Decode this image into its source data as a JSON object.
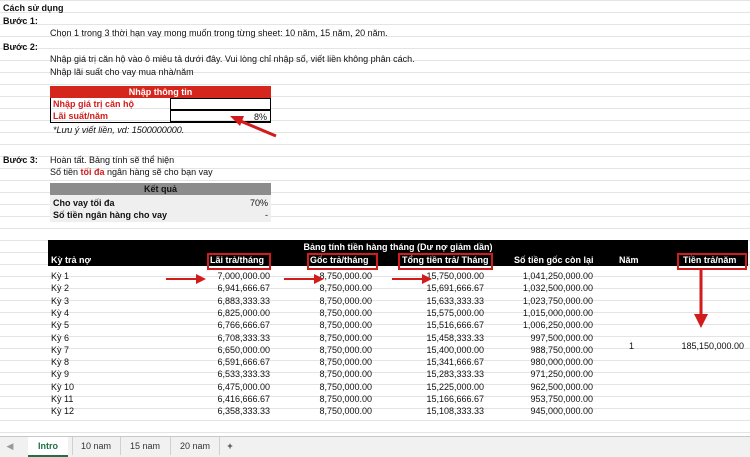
{
  "instructions": {
    "title": "Cách sử dụng",
    "step1_label": "Bước 1:",
    "step1_text": "Chọn 1 trong 3 thời hạn vay mong muốn trong từng sheet: 10 năm, 15 năm, 20 năm.",
    "step2_label": "Bước 2:",
    "step2_text_a": "Nhập giá trị căn hộ vào ô miêu tả dưới đây. Vui lòng chỉ nhập số, viết liền không phân cách.",
    "step2_text_b": "Nhập lãi suất cho vay mua nhà/năm",
    "step3_label": "Bước 3:",
    "step3_text_a": "Hoàn tất. Bảng tính sẽ thể hiện",
    "step3_text_b_pre": "Số tiền ",
    "step3_text_b_em": "tối đa",
    "step3_text_b_post": " ngân hàng sẽ cho bạn vay"
  },
  "input_box": {
    "header": "Nhập thông tin",
    "row1_label": "Nhập giá trị căn hộ",
    "row1_value": "",
    "row2_label": "Lãi suất/năm",
    "row2_value": "8%",
    "note": "*Lưu ý viết liền, vd: 1500000000."
  },
  "result_box": {
    "header": "Kết quả",
    "row1_label": "Cho vay tối đa",
    "row1_value": "70%",
    "row2_label": "Số tiền ngân hàng cho vay",
    "row2_value": "-"
  },
  "schedule": {
    "title": "Bảng tính tiền hàng tháng (Dư nợ giảm dần)",
    "headers": {
      "period": "Kỳ trả nợ",
      "interest": "Lãi trả/tháng",
      "principal": "Gốc trả/tháng",
      "total": "Tổng tiền trả/ Tháng",
      "remaining": "Số tiền gốc còn lại",
      "year": "Năm",
      "yearly": "Tiền trả/năm"
    },
    "rows": [
      {
        "period": "Kỳ 1",
        "interest": "7,000,000.00",
        "principal": "8,750,000.00",
        "total": "15,750,000.00",
        "remaining": "1,041,250,000.00"
      },
      {
        "period": "Kỳ 2",
        "interest": "6,941,666.67",
        "principal": "8,750,000.00",
        "total": "15,691,666.67",
        "remaining": "1,032,500,000.00"
      },
      {
        "period": "Kỳ 3",
        "interest": "6,883,333.33",
        "principal": "8,750,000.00",
        "total": "15,633,333.33",
        "remaining": "1,023,750,000.00"
      },
      {
        "period": "Kỳ 4",
        "interest": "6,825,000.00",
        "principal": "8,750,000.00",
        "total": "15,575,000.00",
        "remaining": "1,015,000,000.00"
      },
      {
        "period": "Kỳ 5",
        "interest": "6,766,666.67",
        "principal": "8,750,000.00",
        "total": "15,516,666.67",
        "remaining": "1,006,250,000.00"
      },
      {
        "period": "Kỳ 6",
        "interest": "6,708,333.33",
        "principal": "8,750,000.00",
        "total": "15,458,333.33",
        "remaining": "997,500,000.00"
      },
      {
        "period": "Kỳ 7",
        "interest": "6,650,000.00",
        "principal": "8,750,000.00",
        "total": "15,400,000.00",
        "remaining": "988,750,000.00"
      },
      {
        "period": "Kỳ 8",
        "interest": "6,591,666.67",
        "principal": "8,750,000.00",
        "total": "15,341,666.67",
        "remaining": "980,000,000.00"
      },
      {
        "period": "Kỳ 9",
        "interest": "6,533,333.33",
        "principal": "8,750,000.00",
        "total": "15,283,333.33",
        "remaining": "971,250,000.00"
      },
      {
        "period": "Kỳ 10",
        "interest": "6,475,000.00",
        "principal": "8,750,000.00",
        "total": "15,225,000.00",
        "remaining": "962,500,000.00"
      },
      {
        "period": "Kỳ 11",
        "interest": "6,416,666.67",
        "principal": "8,750,000.00",
        "total": "15,166,666.67",
        "remaining": "953,750,000.00"
      },
      {
        "period": "Kỳ 12",
        "interest": "6,358,333.33",
        "principal": "8,750,000.00",
        "total": "15,108,333.33",
        "remaining": "945,000,000.00"
      }
    ],
    "year_value": "1",
    "yearly_value": "185,150,000.00"
  },
  "tabs": [
    "Intro",
    "10 nam",
    "15 nam",
    "20 nam"
  ],
  "add_sheet_label": "+",
  "colors": {
    "accent_red": "#d21b1b",
    "header_red": "#d5261d",
    "header_gray": "#8c8c8c",
    "table_black": "#000000",
    "tab_green": "#1e7145"
  }
}
